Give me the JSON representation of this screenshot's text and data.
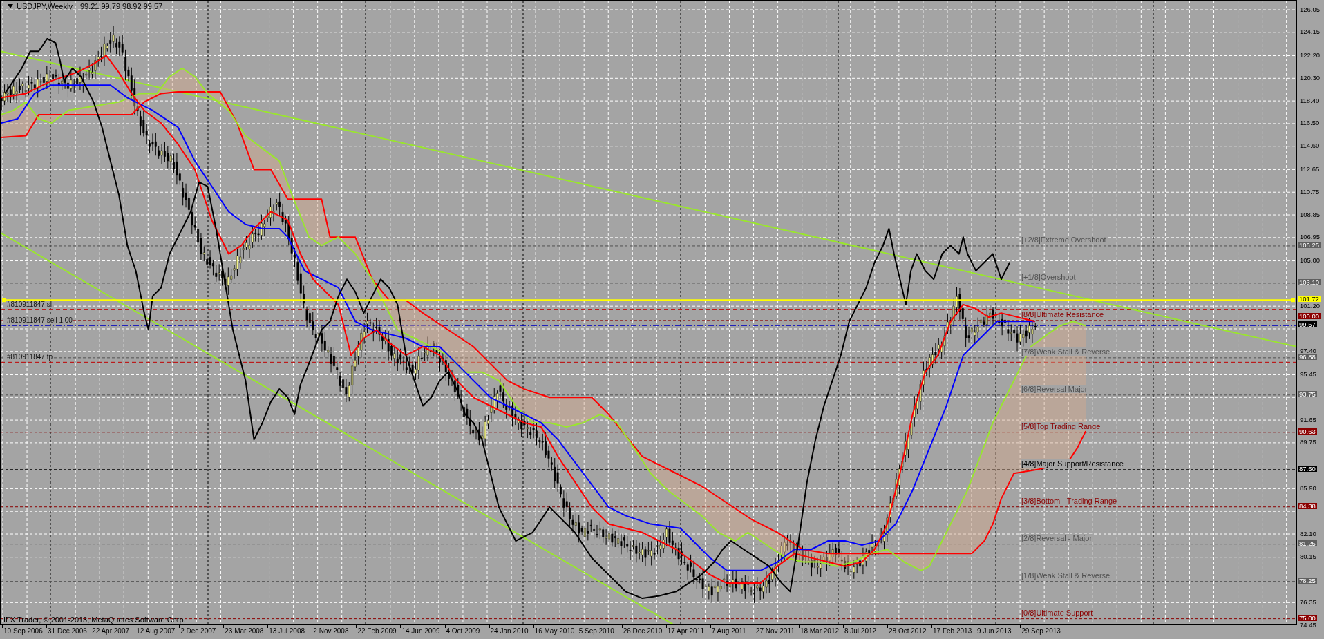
{
  "chart": {
    "header": {
      "symbol": "USDJPY,Weekly",
      "ohlc": "99.21 99.79 98.92 99.57"
    },
    "copyright": "IFX Trader, © 2001-2013, MetaQuotes Software Corp.",
    "orders": [
      {
        "label": "#810911847 sl",
        "kind": "sl"
      },
      {
        "label": "#810911847 sell 1.00",
        "kind": "entry"
      },
      {
        "label": "#810911847 tp",
        "kind": "tp"
      }
    ],
    "levels": [
      {
        "label": "[+2/8]Extreme Overshoot",
        "color": "#505050"
      },
      {
        "label": "[+1/8]Overshoot",
        "color": "#505050"
      },
      {
        "label": "[8/8]Ultimate Resistance",
        "color": "#8b0000"
      },
      {
        "label": "[7/8]Weak Stall & Reverse",
        "color": "#505050"
      },
      {
        "label": "[6/8]Reversal Major",
        "color": "#505050"
      },
      {
        "label": "[5/8]Top Trading Range",
        "color": "#8b0000"
      },
      {
        "label": "[4/8]Major Support/Resistance",
        "color": "#000000"
      },
      {
        "label": "[3/8]Bottom - Trading Range",
        "color": "#8b0000"
      },
      {
        "label": "[2/8]Reversal - Major",
        "color": "#505050"
      },
      {
        "label": "[1/8]Weak Stall & Reverse",
        "color": "#505050"
      },
      {
        "label": "[0/8]Ultimate Support",
        "color": "#8b0000"
      }
    ],
    "price_ticks": [
      "126.05",
      "124.15",
      "122.20",
      "120.30",
      "118.40",
      "116.50",
      "114.60",
      "112.65",
      "110.75",
      "108.85",
      "106.95",
      "105.00",
      "101.20",
      "97.40",
      "95.45",
      "91.65",
      "89.75",
      "85.90",
      "82.10",
      "80.15",
      "76.35",
      "74.45"
    ],
    "price_badges": [
      {
        "text": "106.25",
        "color": "#5f5f5f"
      },
      {
        "text": "103.10",
        "color": "#5f5f5f"
      },
      {
        "text": "101.72",
        "color": "#ffff00"
      },
      {
        "text": "100.00",
        "color": "#8b0000"
      },
      {
        "text": "99.57",
        "color": "#000000"
      },
      {
        "text": "96.88",
        "color": "#5f5f5f"
      },
      {
        "text": "93.75",
        "color": "#5f5f5f"
      },
      {
        "text": "90.63",
        "color": "#8b0000"
      },
      {
        "text": "87.50",
        "color": "#000000"
      },
      {
        "text": "84.38",
        "color": "#8b0000"
      },
      {
        "text": "81.25",
        "color": "#5f5f5f"
      },
      {
        "text": "78.25",
        "color": "#5f5f5f"
      },
      {
        "text": "75.00",
        "color": "#8b0000"
      }
    ],
    "dates": [
      "10 Sep 2006",
      "31 Dec 2006",
      "22 Apr 2007",
      "12 Aug 2007",
      "2 Dec 2007",
      "23 Mar 2008",
      "13 Jul 2008",
      "2 Nov 2008",
      "22 Feb 2009",
      "14 Jun 2009",
      "4 Oct 2009",
      "24 Jan 2010",
      "16 May 2010",
      "5 Sep 2010",
      "26 Dec 2010",
      "17 Apr 2011",
      "7 Aug 2011",
      "27 Nov 2011",
      "18 Mar 2012",
      "8 Jul 2012",
      "28 Oct 2012",
      "17 Feb 2013",
      "9 Jun 2013",
      "29 Sep 2013"
    ]
  }
}
